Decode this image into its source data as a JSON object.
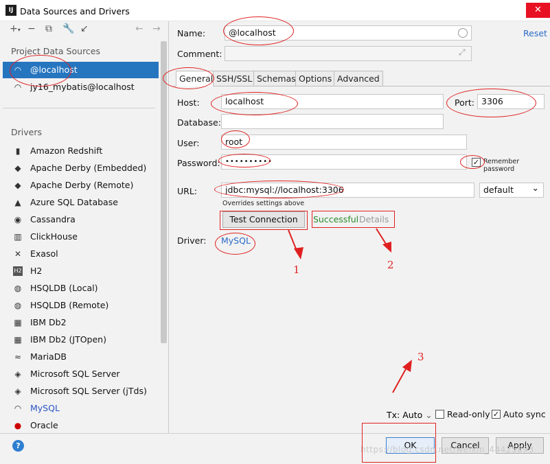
{
  "window": {
    "title": "Data Sources and Drivers",
    "app_icon": "IJ",
    "close_glyph": "✕"
  },
  "toolbar": {
    "add": "+",
    "add_caret": "▾",
    "remove": "−",
    "copy": "⧉",
    "wrench": "🔧",
    "import": "↙",
    "back": "←",
    "forward": "→"
  },
  "left": {
    "project_header": "Project Data Sources",
    "project_sources": [
      {
        "label": "@localhost",
        "icon": "mysql-dolphin-icon"
      },
      {
        "label": "jy16_mybatis@localhost",
        "icon": "mysql-dolphin-icon"
      }
    ],
    "drivers_header": "Drivers",
    "drivers": [
      {
        "label": "Amazon Redshift",
        "glyph": "▮"
      },
      {
        "label": "Apache Derby (Embedded)",
        "glyph": "◆"
      },
      {
        "label": "Apache Derby (Remote)",
        "glyph": "◆"
      },
      {
        "label": "Azure SQL Database",
        "glyph": "▲"
      },
      {
        "label": "Cassandra",
        "glyph": "◉"
      },
      {
        "label": "ClickHouse",
        "glyph": "▥"
      },
      {
        "label": "Exasol",
        "glyph": "✕"
      },
      {
        "label": "H2",
        "glyph": "H2"
      },
      {
        "label": "HSQLDB (Local)",
        "glyph": "◍"
      },
      {
        "label": "HSQLDB (Remote)",
        "glyph": "◍"
      },
      {
        "label": "IBM Db2",
        "glyph": "▦"
      },
      {
        "label": "IBM Db2 (JTOpen)",
        "glyph": "▦"
      },
      {
        "label": "MariaDB",
        "glyph": "≈"
      },
      {
        "label": "Microsoft SQL Server",
        "glyph": "◈"
      },
      {
        "label": "Microsoft SQL Server (jTds)",
        "glyph": "◈"
      },
      {
        "label": "MySQL",
        "glyph": "◠"
      },
      {
        "label": "Oracle",
        "glyph": "●"
      }
    ],
    "help": "?"
  },
  "form": {
    "name_label": "Name:",
    "name_value": "@localhost",
    "reset_link": "Reset",
    "comment_label": "Comment:",
    "comment_value": "",
    "expand_glyph": "⤢",
    "tabs": [
      "General",
      "SSH/SSL",
      "Schemas",
      "Options",
      "Advanced"
    ],
    "host_label": "Host:",
    "host_value": "localhost",
    "port_label": "Port:",
    "port_value": "3306",
    "database_label": "Database:",
    "database_value": "",
    "user_label": "User:",
    "user_value": "root",
    "password_label": "Password:",
    "password_value": "••••••••••",
    "remember_password": "Remember password",
    "remember_checked": "✓",
    "url_label": "URL:",
    "url_value": "jdbc:mysql://localhost:3306",
    "url_mode": "default",
    "url_mode_caret": "⌄",
    "overrides_note": "Overrides settings above",
    "test_connection": "Test Connection",
    "status_success": "Successful",
    "status_details": "Details",
    "driver_label": "Driver:",
    "driver_link": "MySQL"
  },
  "bottom": {
    "tx_label": "Tx: Auto",
    "tx_caret": "⌄",
    "readonly_label": "Read-only",
    "readonly_checked": "",
    "autosync_label": "Auto sync",
    "autosync_checked": "✓",
    "ok": "OK",
    "cancel": "Cancel",
    "apply": "Apply"
  },
  "annotations": {
    "n1": "1",
    "n2": "2",
    "n3": "3"
  },
  "watermark": "https://blog.csdn.net/weixin_44425893",
  "colors": {
    "selection": "#2675bf",
    "link": "#2a6ac8",
    "success": "#2b8a2b",
    "annotation": "#e02020"
  }
}
